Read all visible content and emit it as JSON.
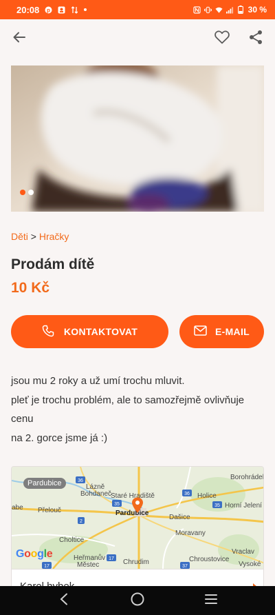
{
  "status_bar": {
    "time": "20:08",
    "battery": "30 %",
    "background": "#ff5a16",
    "icons_left": [
      "pinterest-icon",
      "gallery-icon",
      "data-icon",
      "dot-icon"
    ],
    "icons_right": [
      "nfc-icon",
      "vibrate-icon",
      "wifi-icon",
      "signal-icon",
      "battery-icon"
    ]
  },
  "app_bar": {
    "back_icon": "arrow-left-icon",
    "favorite_icon": "heart-outline-icon",
    "share_icon": "share-icon"
  },
  "gallery": {
    "total_images": 2,
    "active_index": 0,
    "active_dot_color": "#ff5a16",
    "inactive_dot_color": "#ffffff"
  },
  "breadcrumb": {
    "items": [
      "Děti",
      "Hračky"
    ],
    "separator": ">"
  },
  "listing": {
    "title": "Prodám dítě",
    "price": "10 Kč",
    "description": [
      "jsou mu 2 roky a už umí trochu mluvit.",
      "pleť je trochu problém, ale to samozřejmě ovlivňuje cenu",
      "na 2. gorce jsme já :)"
    ]
  },
  "buttons": {
    "contact_label": "KONTAKTOVAT",
    "contact_icon": "phone-icon",
    "email_label": "E-MAIL",
    "email_icon": "envelope-icon",
    "accent": "#ff5a16"
  },
  "map": {
    "city_chip": "Pardubice",
    "labels": {
      "borohradek": "Borohrádek",
      "lazne": "Lázně",
      "bohdanec": "Bohdaneč",
      "stare_hradiste": "Staré Hradiště",
      "holice": "Holice",
      "abe": "abe",
      "prelouc": "Přelouč",
      "pardubice": "Pardubice",
      "horni_jeleni": "Horní Jelení",
      "dasice": "Dašice",
      "moravany": "Moravany",
      "choltice": "Choltice",
      "hermanuv": "Heřmanův",
      "mestec": "Městec",
      "chrudim": "Chrudim",
      "chroustovice": "Chroustovice",
      "vraclav": "Vraclav",
      "vysoke": "Vysoké"
    },
    "shields": {
      "r36a": "36",
      "r36b": "36",
      "r35a": "35",
      "r35b": "35",
      "r2": "2",
      "r17a": "17",
      "r17b": "17",
      "r37": "37"
    },
    "provider": "Google",
    "pin_icon": "location-pin-icon",
    "pin_color": "#f26a1b"
  },
  "seller": {
    "name": "Karel hybek",
    "chevron_icon": "chevron-right-icon"
  },
  "nav_bar": {
    "back_icon": "nav-back-icon",
    "home_icon": "nav-home-icon",
    "recents_icon": "nav-recents-icon"
  }
}
